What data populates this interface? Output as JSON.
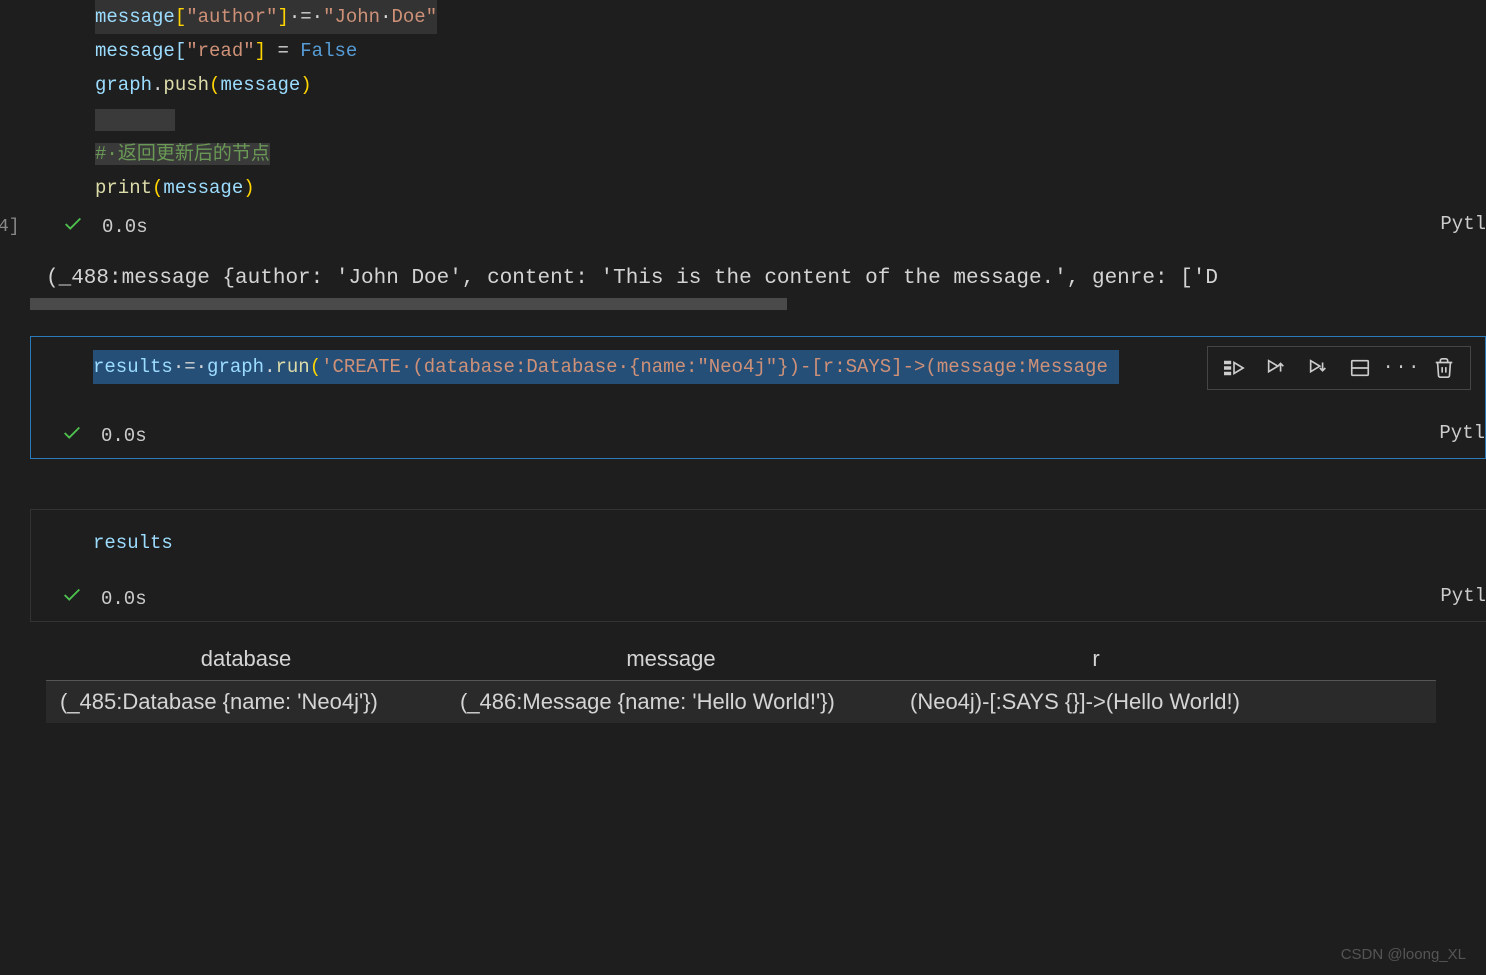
{
  "code1": {
    "l1": "message[\"author\"] = \"John Doe\"",
    "l2_prefix": "message[",
    "l2_key": "\"read\"",
    "l2_bracket_close": "]",
    "l2_eq": " = ",
    "l2_val": "False",
    "l3_a": "graph",
    "l3_dot": ".",
    "l3_b": "push",
    "l3_p1": "(",
    "l3_c": "message",
    "l3_p2": ")",
    "comment_hash": "#",
    "comment_dot": "·",
    "comment_text": "返回更新后的节点",
    "l5_print": "print",
    "l5_p1": "(",
    "l5_msg": "message",
    "l5_p2": ")"
  },
  "cell1_status": {
    "time": "0.0s",
    "lang": "Pytl",
    "prefix": "4]"
  },
  "output1": "(_488:message {author: 'John Doe', content: 'This is the content of the message.', genre: ['D",
  "code2": {
    "var": "results",
    "sp1": "·",
    "eq": "=",
    "sp2": "·",
    "graph": "graph",
    "dot": ".",
    "run": "run",
    "p1": "(",
    "str_open": "'CREATE",
    "sp3": "·",
    "str_mid1": "(database:Database",
    "sp4": "·",
    "str_mid2": "{name:\"Neo4j\"})-[r:SAYS]->(message:Message ",
    "full_text": "results = graph.run('CREATE (database:Database {name:\"Neo4j\"})-[r:SAYS]->(message:Message "
  },
  "cell2_status": {
    "time": "0.0s",
    "lang": "Pytl"
  },
  "code3": {
    "var": "results"
  },
  "cell3_status": {
    "time": "0.0s",
    "lang": "Pytl"
  },
  "table": {
    "headers": [
      "database",
      "message",
      "r"
    ],
    "row": [
      "(_485:Database {name: 'Neo4j'})",
      "(_486:Message {name: 'Hello World!'})",
      "(Neo4j)-[:SAYS {}]->(Hello World!)"
    ]
  },
  "watermark": "CSDN @loong_XL",
  "gutter": {
    "collapse": "∨"
  }
}
